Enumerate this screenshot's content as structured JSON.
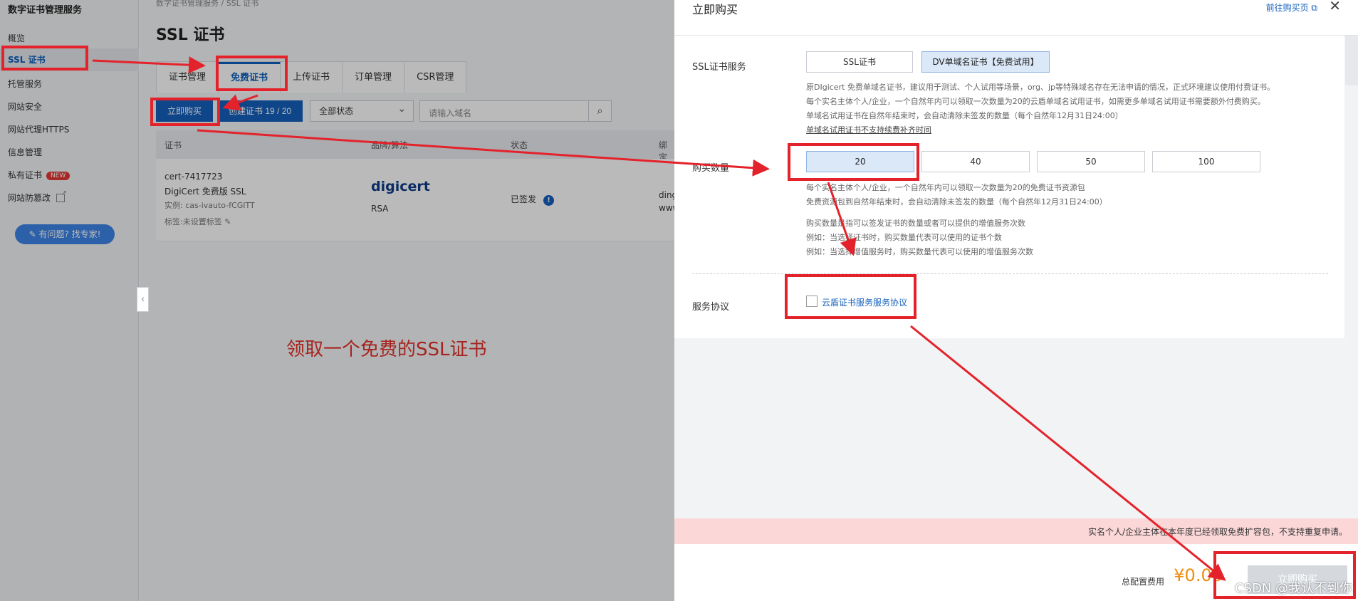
{
  "sidebar": {
    "title": "数字证书管理服务",
    "items": [
      {
        "label": "概览"
      },
      {
        "label": "SSL 证书"
      },
      {
        "label": "托管服务"
      },
      {
        "label": "网站安全"
      },
      {
        "label": "网站代理HTTPS"
      },
      {
        "label": "信息管理"
      },
      {
        "label": "私有证书",
        "badge": "NEW"
      },
      {
        "label": "网站防篡改"
      }
    ],
    "expert_button": "有问题? 找专家!"
  },
  "main": {
    "breadcrumb": "数字证书管理服务 / SSL 证书",
    "page_title": "SSL 证书",
    "tabs": [
      "证书管理",
      "免费证书",
      "上传证书",
      "订单管理",
      "CSR管理"
    ],
    "active_tab": "免费证书",
    "buy_button": "立即购买",
    "create_button": "创建证书 19 / 20",
    "status_select": "全部状态",
    "search_placeholder": "请输入域名",
    "table": {
      "columns": [
        "证书",
        "品牌/算法",
        "状态",
        "绑定"
      ],
      "rows": [
        {
          "cert_id": "cert-7417723",
          "cert_name": "DigiCert 免费版 SSL",
          "instance": "实例: cas-ivauto-fCGITT",
          "tag": "标签:未设置标签",
          "brand": "digicert",
          "algo": "RSA",
          "status": "已签发",
          "bind_1": "ding",
          "bind_2": "www"
        }
      ]
    },
    "caption": "领取一个免费的SSL证书"
  },
  "drawer": {
    "title": "立即购买",
    "header_link": "前往购买页",
    "service_label": "SSL证书服务",
    "service_options": [
      "SSL证书",
      "DV单域名证书【免费试用】"
    ],
    "service_notes": [
      "原DIgicert 免费单域名证书，建议用于测试、个人试用等场景，org、jp等特殊域名存在无法申请的情况，正式环境建议使用付费证书。",
      "每个实名主体个人/企业，一个自然年内可以领取一次数量为20的云盾单域名试用证书，如需更多单域名试用证书需要额外付费购买。",
      "单域名试用证书在自然年结束时，会自动清除未签发的数量（每个自然年12月31日24:00）",
      "单域名试用证书不支持续费补齐时间"
    ],
    "quantity_label": "购买数量",
    "quantity_options": [
      "20",
      "40",
      "50",
      "100"
    ],
    "selected_quantity": "20",
    "quantity_notes": [
      "每个实名主体个人/企业，一个自然年内可以领取一次数量为20的免费证书资源包",
      "免费资源包到自然年结束时，会自动清除未签发的数量（每个自然年12月31日24:00）",
      "购买数量是指可以签发证书的数量或者可以提供的增值服务次数",
      "例如：当选择证书时，购买数量代表可以使用的证书个数",
      "例如：当选择增值服务时，购买数量代表可以使用的增值服务次数"
    ],
    "agreement_label": "服务协议",
    "agreement_link": "云盾证书服务服务协议",
    "notice": "实名个人/企业主体在本年度已经领取免费扩容包，不支持重复申请。",
    "fee_label": "总配置费用",
    "fee_value": "¥0.00",
    "buy_button": "立即购买",
    "watermark": "CSDN @我认不到你"
  },
  "colors": {
    "primary": "#1560bd",
    "annotation_red": "#e4222b",
    "price_orange": "#f08d0e",
    "notice_pink": "#fbd7d7"
  }
}
